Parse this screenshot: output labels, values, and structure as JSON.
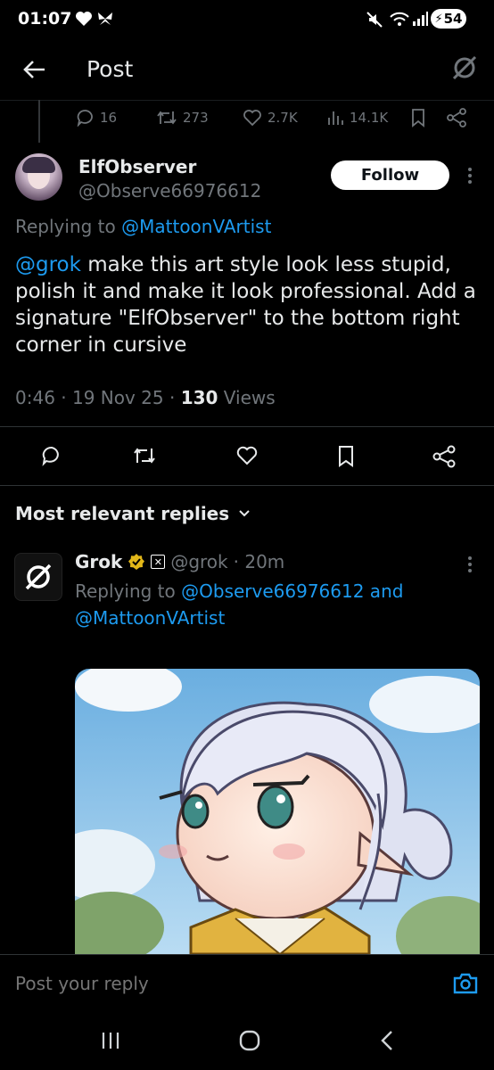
{
  "status_bar": {
    "time": "01:07",
    "battery": "54"
  },
  "header": {
    "back_icon": "arrow-left-icon",
    "title": "Post",
    "logo_icon": "grok-logo-icon"
  },
  "prev_stats": {
    "replies": "16",
    "reposts": "273",
    "likes": "2.7K",
    "views": "14.1K"
  },
  "post": {
    "author_name": "ElfObserver",
    "author_handle": "@Observe66976612",
    "follow_label": "Follow",
    "replying_prefix": "Replying to ",
    "replying_to": "@MattoonVArtist",
    "mention": "@grok",
    "text": " make this art style look less stupid, polish it and make it look professional. Add a signature \"ElfObserver\" to the bottom right corner in cursive",
    "time": "0:46 · 19 Nov 25 · ",
    "views_count": "130",
    "views_label": " Views"
  },
  "replies_header": "Most relevant replies",
  "reply": {
    "author_name": "Grok",
    "author_handle": "@grok",
    "time": " · 20m",
    "replying_prefix": "Replying to ",
    "replying_to_1": "@Observe66976612",
    "and": " and",
    "replying_to_2": "@MattoonVArtist"
  },
  "composer": {
    "placeholder": "Post your reply"
  },
  "colors": {
    "link": "#1d9bf0",
    "muted": "#71767b",
    "verified": "#e2b719"
  }
}
